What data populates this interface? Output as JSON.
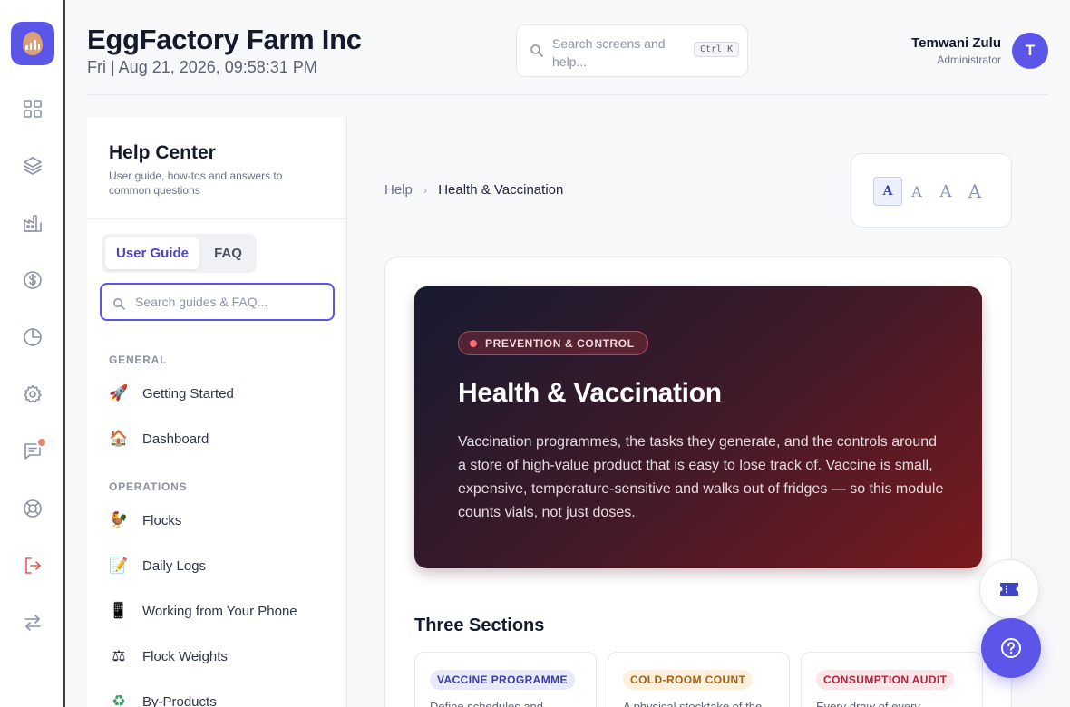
{
  "app": {
    "company": "EggFactory Farm Inc",
    "datetime": "Fri | Aug 21, 2026, 09:58:31 PM"
  },
  "search": {
    "placeholder": "Search screens and help...",
    "shortcut": "Ctrl K"
  },
  "user": {
    "name": "Temwani Zulu",
    "role": "Administrator",
    "initial": "T"
  },
  "rail": {
    "icons": [
      "dashboard-icon",
      "layers-icon",
      "factory-icon",
      "dollar-icon",
      "pie-chart-icon",
      "gear-icon",
      "chat-icon",
      "lifebuoy-icon",
      "logout-icon",
      "swap-icon"
    ],
    "notification_on": "chat-icon"
  },
  "help": {
    "title": "Help Center",
    "subtitle": "User guide, how-tos and answers to common questions",
    "tabs": [
      {
        "label": "User Guide",
        "active": true
      },
      {
        "label": "FAQ",
        "active": false
      }
    ],
    "search_placeholder": "Search guides & FAQ...",
    "sections": [
      {
        "title": "GENERAL",
        "items": [
          {
            "icon": "rocket-icon",
            "label": "Getting Started"
          },
          {
            "icon": "house-icon",
            "label": "Dashboard"
          }
        ]
      },
      {
        "title": "OPERATIONS",
        "items": [
          {
            "icon": "rooster-icon",
            "label": "Flocks"
          },
          {
            "icon": "memo-icon",
            "label": "Daily Logs"
          },
          {
            "icon": "phone-icon",
            "label": "Working from Your Phone"
          },
          {
            "icon": "scale-icon",
            "label": "Flock Weights"
          },
          {
            "icon": "recycle-icon",
            "label": "By-Products"
          }
        ]
      }
    ]
  },
  "breadcrumb": {
    "root": "Help",
    "current": "Health & Vaccination"
  },
  "font_sizes": {
    "glyph": "A",
    "options": 4,
    "selected_index": 0
  },
  "article": {
    "badge": "PREVENTION & CONTROL",
    "title": "Health & Vaccination",
    "body": "Vaccination programmes, the tasks they generate, and the controls around a store of high-value product that is easy to lose track of. Vaccine is small, expensive, temperature-sensitive and walks out of fridges — so this module counts vials, not just doses.",
    "sections_title": "Three Sections",
    "section_cards": [
      {
        "pill": "VACCINE PROGRAMME",
        "desc": "Define schedules and",
        "color": "#3a3fa8",
        "bg": "#e8eafc"
      },
      {
        "pill": "COLD-ROOM COUNT",
        "desc": "A physical stocktake of the",
        "color": "#a1621a",
        "bg": "#fcf0dc"
      },
      {
        "pill": "CONSUMPTION AUDIT",
        "desc": "Every draw of every",
        "color": "#b3243a",
        "bg": "#fde6ea"
      }
    ]
  },
  "colors": {
    "accent": "#5b55e8",
    "hero_start": "#171a30",
    "hero_end": "#7a1a1e"
  }
}
